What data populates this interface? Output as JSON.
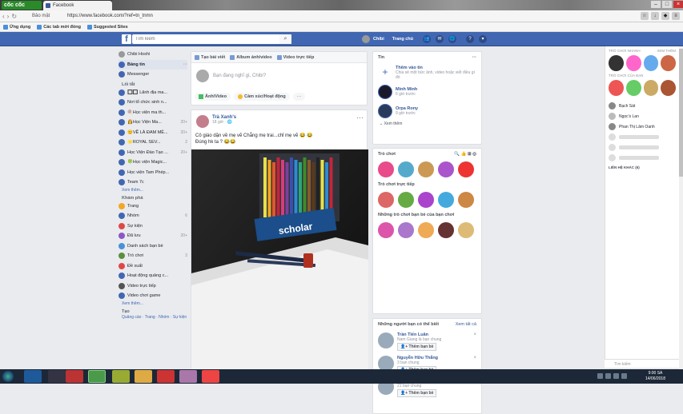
{
  "browser": {
    "brand": "cốc cốc",
    "tab_title": "Facebook",
    "address": "https://www.facebook.com/?ref=tn_tnmn",
    "security": "Bảo mật",
    "bookmarks": [
      "Ứng dụng",
      "Các tab mới đóng",
      "Suggested Sites"
    ]
  },
  "fb": {
    "search_placeholder": "Tìm kiếm",
    "user_name": "Chibi",
    "home": "Trang chủ"
  },
  "left": {
    "profile": "Chibi Hoshi",
    "items": [
      {
        "label": "Bảng tin",
        "selected": true
      },
      {
        "label": "Messenger"
      }
    ],
    "shortcuts_head": "Lối tắt",
    "shortcuts": [
      {
        "label": "🔲🔲 Lãnh địa ma...",
        "count": ""
      },
      {
        "label": "Nơi tổ chức sinh n...",
        "count": ""
      },
      {
        "label": "🍭Học viện ma th...",
        "count": ""
      },
      {
        "label": "👸Học Viện Ma...",
        "count": "20+"
      },
      {
        "label": "😊VẼ LÀ ĐAM MÊ...",
        "count": "20+"
      },
      {
        "label": "🌟ROYAL SEV...",
        "count": "2"
      },
      {
        "label": "Học Viện Đào Tạo ...",
        "count": "20+"
      },
      {
        "label": "🍀Học viện Magic...",
        "count": ""
      },
      {
        "label": "Học viện Tam Phép...",
        "count": ""
      },
      {
        "label": "Team 7c",
        "count": ""
      }
    ],
    "see_more": "Xem thêm...",
    "explore_head": "Khám phá",
    "explore": [
      {
        "label": "Trang",
        "count": ""
      },
      {
        "label": "Nhóm",
        "count": "6"
      },
      {
        "label": "Sự kiện",
        "count": ""
      },
      {
        "label": "Đã lưu",
        "count": "20+"
      },
      {
        "label": "Danh sách bạn bè",
        "count": ""
      },
      {
        "label": "Trò chơi",
        "count": "3"
      },
      {
        "label": "Đề xuất",
        "count": ""
      },
      {
        "label": "Hoạt động quảng c...",
        "count": ""
      },
      {
        "label": "Video trực tiếp",
        "count": ""
      },
      {
        "label": "Video chơi game",
        "count": ""
      }
    ],
    "see_more2": "Xem thêm...",
    "create_head": "Tạo",
    "create_links": "Quảng cáo · Trang · Nhóm · Sự kiện"
  },
  "composer": {
    "tab_post": "Tạo bài viết",
    "tab_album": "Album ảnh/video",
    "tab_live": "Video trực tiếp",
    "placeholder": "Bạn đang nghĩ gì, Chibi?",
    "act_photo": "Ảnh/Video",
    "act_feeling": "Cảm xúc/Hoạt động",
    "act_more": "···"
  },
  "post": {
    "author": "Trà Xanh's",
    "time": "18 giờ · ",
    "text1": "Cô giáo dặn về mẹ vẽ Chẳng mẹ trai...chỉ mẹ vẽ 😂 😂",
    "text2": "Đúng hk ta ? 😂😂",
    "brand_text": "scholar"
  },
  "right": {
    "stories_title": "Tin",
    "add_story": "Thêm vào tin",
    "add_story_sub": "Chia sẻ một bức ảnh, video hoặc viết điều gì đó",
    "stories": [
      {
        "name": "Minh Minh",
        "time": "6 giờ trước"
      },
      {
        "name": "Orpa Rony",
        "time": "9 giờ trước"
      }
    ],
    "see_more": "Xem thêm",
    "games_title": "Trò chơi",
    "live_games_title": "Trò chơi trực tiếp",
    "friend_games_title": "Những trò chơi bạn bè của bạn chơi",
    "pymk_title": "Những người bạn có thể biết",
    "pymk_all": "Xem tất cả",
    "pymk": [
      {
        "name": "Trần Tiến Luân",
        "sub": "Nam Giang là bạn chung",
        "btn": "Thêm bạn bè"
      },
      {
        "name": "Nguyễn Hữu Thắng",
        "sub": "3 bạn chung",
        "btn": "Thêm bạn bè"
      },
      {
        "name": "Levi Ackerman",
        "sub": "21 bạn chung",
        "btn": "Thêm bạn bè"
      }
    ]
  },
  "chat": {
    "games_head": "TRÒ CHƠI NHANH",
    "games_all": "XEM THÊM",
    "groups_head": "TRÒ CHƠI CỦA BẠN",
    "contacts": [
      "Bạch Sát",
      "Ngọc's Lan",
      "Phan Thị Lâm Oanh"
    ],
    "more_contacts": "LIÊN HỆ KHÁC (6)",
    "search": "Tìm kiếm"
  },
  "taskbar": {
    "time": "9:00 SA",
    "date": "14/06/2018"
  },
  "colors": {
    "fb_blue": "#4267b2",
    "link": "#365899"
  }
}
